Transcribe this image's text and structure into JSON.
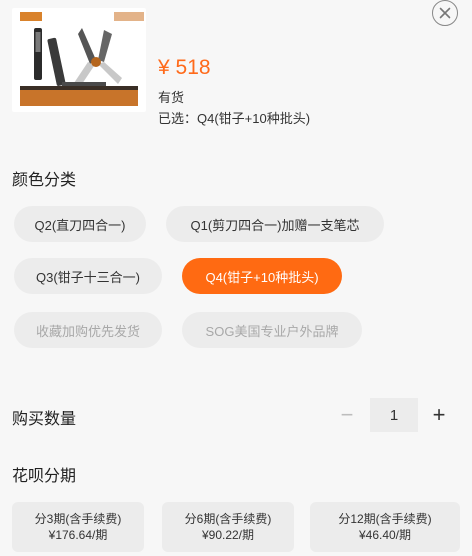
{
  "product": {
    "price": "¥ 518",
    "stock": "有货",
    "selected": "已选：Q4(钳子+10种批头)"
  },
  "color_section": {
    "title": "颜色分类",
    "options": [
      {
        "label": "Q2(直刀四合一)",
        "state": "normal"
      },
      {
        "label": "Q1(剪刀四合一)加赠一支笔芯",
        "state": "normal"
      },
      {
        "label": "Q3(钳子十三合一)",
        "state": "normal"
      },
      {
        "label": "Q4(钳子+10种批头)",
        "state": "selected"
      },
      {
        "label": "收藏加购优先发货",
        "state": "disabled"
      },
      {
        "label": "SOG美国专业户外品牌",
        "state": "disabled"
      }
    ]
  },
  "quantity": {
    "title": "购买数量",
    "minus": "−",
    "value": "1",
    "plus": "+"
  },
  "installments": {
    "title": "花呗分期",
    "plans": [
      {
        "period": "分3期(含手续费)",
        "amount": "¥176.64/期"
      },
      {
        "period": "分6期(含手续费)",
        "amount": "¥90.22/期"
      },
      {
        "period": "分12期(含手续费)",
        "amount": "¥46.40/期"
      }
    ]
  },
  "colors": {
    "accent": "#ff6a12",
    "chip_bg": "#ececec",
    "disabled_text": "#a8a8a8"
  },
  "icons": {
    "close": "close-icon"
  }
}
